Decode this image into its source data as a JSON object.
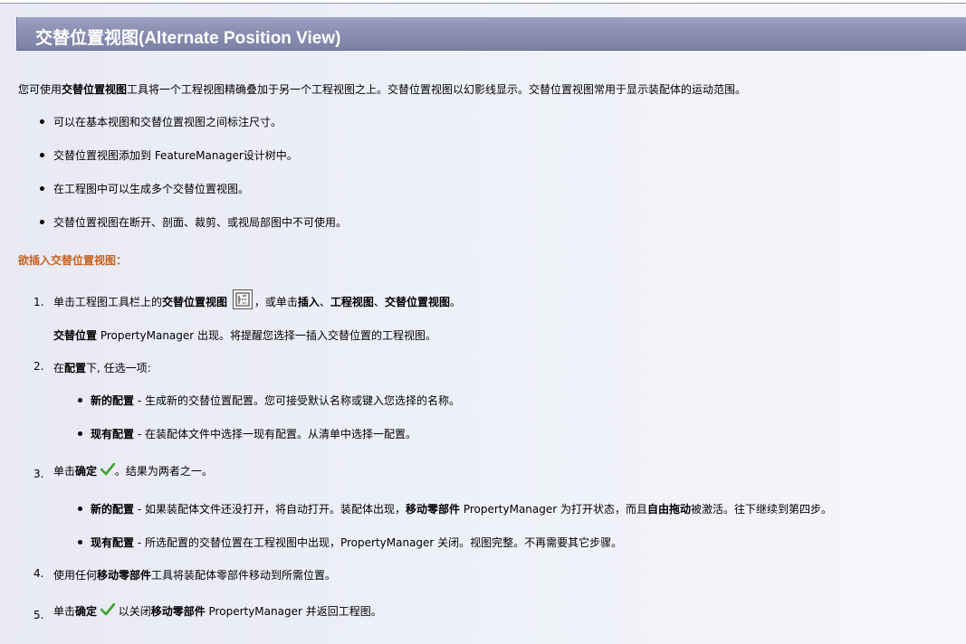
{
  "banner": {
    "title": "交替位置视图(Alternate Position View)"
  },
  "intro": {
    "pre": "您可使用",
    "bold": "交替位置视图",
    "post": "工具将一个工程视图精确叠加于另一个工程视图之上。交替位置视图以幻影线显示。交替位置视图常用于显示装配体的运动范围。"
  },
  "bullets": [
    "可以在基本视图和交替位置视图之间标注尺寸。",
    "交替位置视图添加到 FeatureManager设计树中。",
    "在工程图中可以生成多个交替位置视图。",
    "交替位置视图在断开、剖面、裁剪、或视局部图中不可使用。"
  ],
  "section_heading": "欲插入交替位置视图：",
  "steps": {
    "s1": {
      "num": "1.",
      "pre": "单击工程图工具栏上的",
      "bold1": "交替位置视图",
      "mid": "，或单击",
      "bold2": "插入",
      "sep1": "、",
      "bold3": "工程视图",
      "sep2": "、",
      "bold4": "交替位置视图",
      "end": "。",
      "sub_bold": "交替位置",
      "sub_rest": " PropertyManager 出现。将提醒您选择一插入交替位置的工程视图。"
    },
    "s2": {
      "num": "2.",
      "pre": "在",
      "bold": "配置",
      "post": "下, 任选一项:",
      "items": [
        {
          "bold": "新的配置",
          "text": " - 生成新的交替位置配置。您可接受默认名称或键入您选择的名称。"
        },
        {
          "bold": "现有配置",
          "text": " - 在装配体文件中选择一现有配置。从清单中选择一配置。"
        }
      ]
    },
    "s3": {
      "num": "3.",
      "pre": "单击",
      "bold": "确定",
      "post": "。结果为两者之一。",
      "item1": {
        "bold": "新的配置",
        "t1": " - 如果装配体文件还没打开，将自动打开。装配体出现，",
        "b2": "移动零部件",
        "t2": " PropertyManager 为打开状态，而且",
        "b3": "自由拖动",
        "t3": "被激活。往下继续到第四步。"
      },
      "item2": {
        "bold": "现有配置",
        "text": " - 所选配置的交替位置在工程视图中出现，PropertyManager 关闭。视图完整。不再需要其它步骤。"
      }
    },
    "s4": {
      "num": "4.",
      "pre": "使用任何",
      "bold": "移动零部件",
      "post": "工具将装配体零部件移动到所需位置。"
    },
    "s5": {
      "num": "5.",
      "pre": "单击",
      "bold": "确定",
      "mid": "以关闭",
      "bold2": "移动零部件",
      "post": " PropertyManager 并返回工程图。"
    }
  },
  "icons": [
    "alternate-position-view-icon",
    "checkmark-icon"
  ],
  "colors": {
    "banner": "#8a8fb2",
    "heading": "#c8601a",
    "check": "#3aa52a"
  }
}
